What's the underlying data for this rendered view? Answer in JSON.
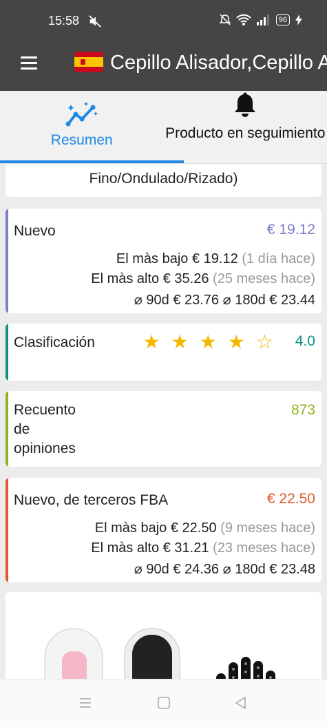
{
  "status_bar": {
    "time": "15:58",
    "battery": "96"
  },
  "app_bar": {
    "title": "Cepillo Alisador,Cepillo Alisador de Pelo"
  },
  "tabs": [
    {
      "label": "Resumen",
      "icon": "chart-sparkle-icon",
      "active": true
    },
    {
      "label": "Producto en seguimiento",
      "icon": "bell-icon",
      "active": false
    }
  ],
  "top_card": {
    "text": "Fino/Ondulado/Rizado)"
  },
  "nuevo": {
    "label": "Nuevo",
    "price": "€ 19.12",
    "color": "#7b7fc8",
    "lowest_label": "El màs bajo",
    "lowest_price": "€ 19.12",
    "lowest_when": "(1 día hace)",
    "highest_label": "El màs alto",
    "highest_price": "€ 35.26",
    "highest_when": "(25 meses hace)",
    "avg90_label": "⌀ 90d",
    "avg90": "€ 23.76",
    "avg180_label": "⌀ 180d",
    "avg180": "€ 23.44"
  },
  "clasificacion": {
    "label": "Clasificación",
    "rating": 4,
    "max": 5,
    "value": "4.0",
    "color": "#119186"
  },
  "recuento": {
    "label": "Recuento de opiniones",
    "value": "873",
    "color": "#8db420"
  },
  "fba": {
    "label": "Nuevo, de terceros FBA",
    "price": "€ 22.50",
    "color": "#e0592c",
    "lowest_label": "El màs bajo",
    "lowest_price": "€ 22.50",
    "lowest_when": "(9 meses hace)",
    "highest_label": "El màs alto",
    "highest_price": "€ 31.21",
    "highest_when": "(23 meses hace)",
    "avg90_label": "⌀ 90d",
    "avg90": "€ 24.36",
    "avg180_label": "⌀ 180d",
    "avg180": "€ 23.48"
  },
  "colors": {
    "header": "#454545",
    "accent": "#1e88e5",
    "star": "#f5b800"
  }
}
